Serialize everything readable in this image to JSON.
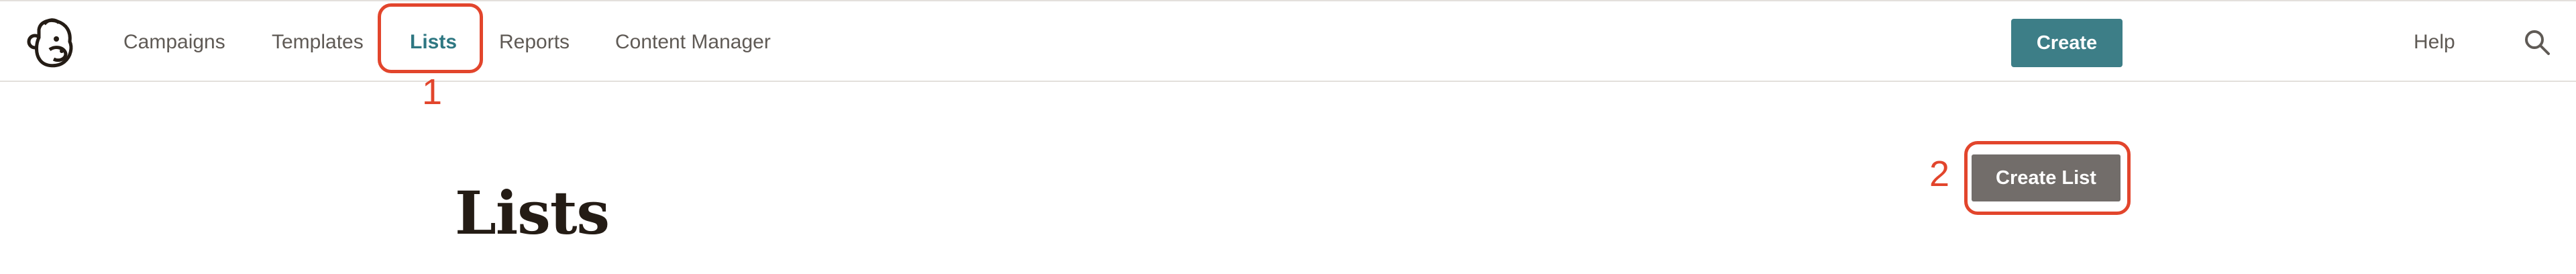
{
  "nav": {
    "logo_icon": "mailchimp-freddie-logo-icon",
    "items": [
      {
        "label": "Campaigns",
        "active": false
      },
      {
        "label": "Templates",
        "active": false
      },
      {
        "label": "Lists",
        "active": true
      },
      {
        "label": "Reports",
        "active": false
      },
      {
        "label": "Content Manager",
        "active": false
      }
    ],
    "create_label": "Create",
    "help_label": "Help",
    "search_icon": "search-icon"
  },
  "main": {
    "title": "Lists",
    "create_list_label": "Create List"
  },
  "annotations": {
    "step1": "1",
    "step2": "2"
  },
  "colors": {
    "accent": "#3d7e87",
    "active_nav": "#2e7782",
    "secondary_button": "#726d6a",
    "annotation": "#e2452c"
  }
}
